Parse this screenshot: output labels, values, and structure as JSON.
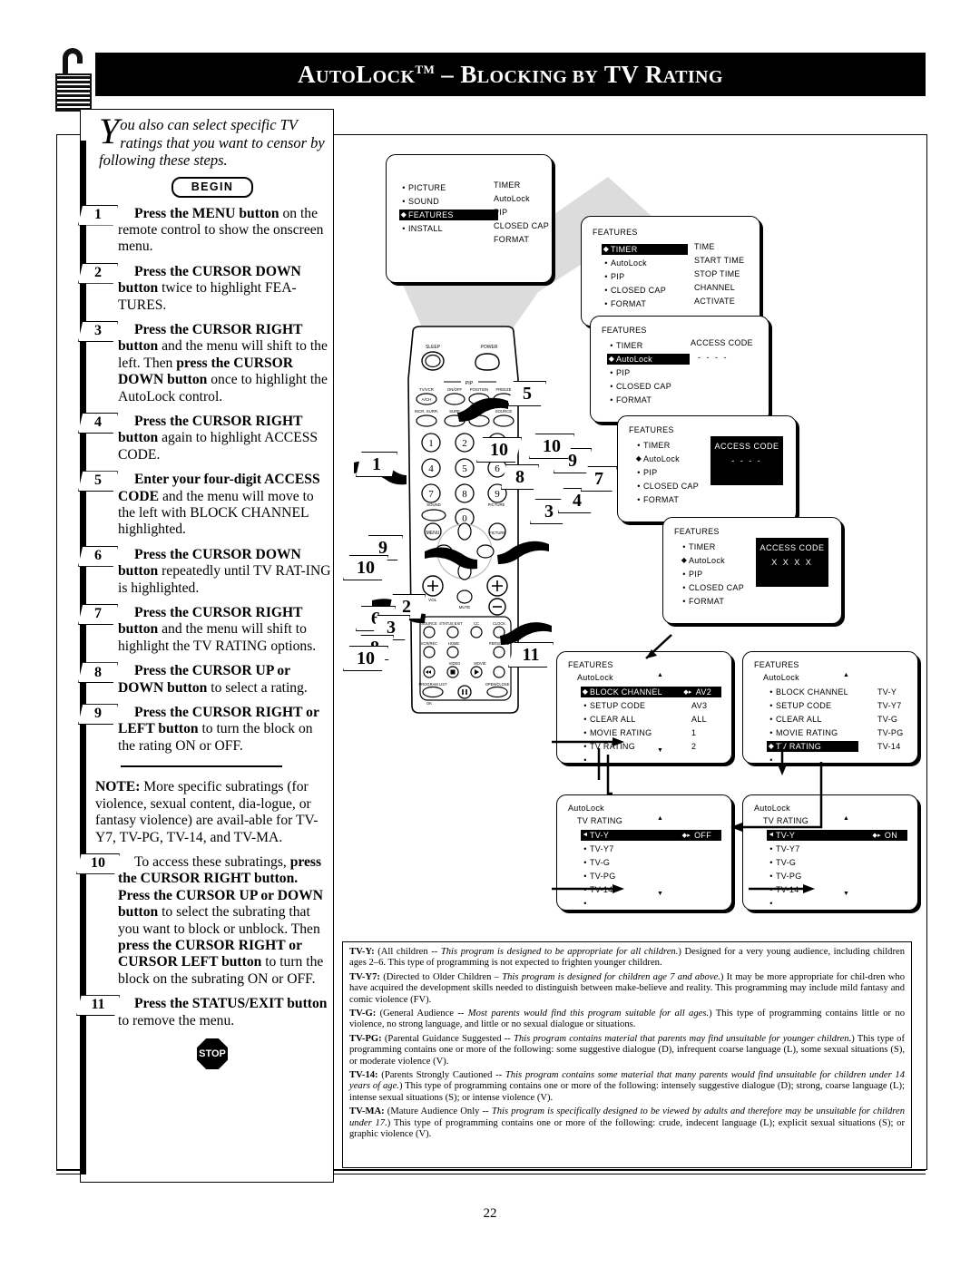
{
  "header": {
    "title_parts": {
      "a": "A",
      "b": "UTO",
      "c": "L",
      "d": "OCK",
      "tm": "TM",
      "dash": " – ",
      "e": "B",
      "f": "LOCKING",
      "g": " BY ",
      "h": "TV ",
      "i": "R",
      "j": "ATING"
    },
    "title_plain": "AutoLock™ – Blocking by TV Rating",
    "lock_icon": "padlock-open-icon"
  },
  "intro": {
    "dropcap": "Y",
    "text": "ou also can select specific TV ratings that you want to censor by following these steps."
  },
  "badges": {
    "begin": "BEGIN",
    "stop": "STOP"
  },
  "steps": [
    {
      "n": "1",
      "html": "<b>Press the MENU button</b> on the remote control to show the onscreen menu."
    },
    {
      "n": "2",
      "html": "<b>Press the CURSOR DOWN button</b> twice to highlight FEA-TURES."
    },
    {
      "n": "3",
      "html": "<b>Press the CURSOR RIGHT button</b> and the menu will shift to the left. Then <b>press the CURSOR DOWN button</b> once to highlight the AutoLock control."
    },
    {
      "n": "4",
      "html": "<b>Press the CURSOR RIGHT button</b> again to highlight ACCESS CODE."
    },
    {
      "n": "5",
      "html": "<b>Enter your four-digit ACCESS CODE</b> and the menu will move to the left with BLOCK CHANNEL highlighted."
    },
    {
      "n": "6",
      "html": "<b>Press the CURSOR DOWN button</b> repeatedly until TV RAT-ING is highlighted."
    },
    {
      "n": "7",
      "html": "<b>Press the CURSOR RIGHT button</b> and the menu will shift to highlight the TV RATING options."
    },
    {
      "n": "8",
      "html": "<b>Press the CURSOR UP or DOWN button</b> to select a rating."
    },
    {
      "n": "9",
      "html": "<b>Press the CURSOR RIGHT or LEFT button</b> to turn the block on the rating ON or OFF."
    }
  ],
  "note": {
    "label": "NOTE:",
    "text": " More specific subratings (for violence, sexual content, dia-logue, or fantasy violence) are avail-able for TV-Y7, TV-PG, TV-14, and TV-MA."
  },
  "steps_after_note": [
    {
      "n": "10",
      "html": "To access these subratings, <b>press the CURSOR RIGHT button. Press the CURSOR UP or DOWN button</b> to select the subrating that you want to block or unblock. Then <b>press the CURSOR RIGHT or CURSOR LEFT button</b> to turn the block on the subrating ON or OFF."
    },
    {
      "n": "11",
      "html": "<b>Press the STATUS/EXIT button</b> to remove the menu."
    }
  ],
  "screens": {
    "s1": {
      "items": [
        {
          "bullet": "•",
          "label": "PICTURE",
          "hl": false
        },
        {
          "bullet": "•",
          "label": "SOUND",
          "hl": false
        },
        {
          "bullet": "cursor",
          "label": "FEATURES",
          "hl": true
        },
        {
          "bullet": "•",
          "label": "INSTALL",
          "hl": false
        }
      ],
      "right": [
        "TIMER",
        "AutoLock",
        "PIP",
        "CLOSED CAP",
        "FORMAT"
      ]
    },
    "s2": {
      "header": "FEATURES",
      "items": [
        {
          "bullet": "cursor",
          "label": "TIMER",
          "hl": true
        },
        {
          "bullet": "•",
          "label": "AutoLock",
          "hl": false
        },
        {
          "bullet": "•",
          "label": "PIP",
          "hl": false
        },
        {
          "bullet": "•",
          "label": "CLOSED CAP",
          "hl": false
        },
        {
          "bullet": "•",
          "label": "FORMAT",
          "hl": false
        }
      ],
      "right": [
        "TIME",
        "START TIME",
        "STOP TIME",
        "CHANNEL",
        "ACTIVATE"
      ]
    },
    "s3": {
      "header": "FEATURES",
      "items": [
        {
          "bullet": "•",
          "label": "TIMER",
          "hl": false
        },
        {
          "bullet": "cursor",
          "label": "AutoLock",
          "hl": true
        },
        {
          "bullet": "•",
          "label": "PIP",
          "hl": false
        },
        {
          "bullet": "•",
          "label": "CLOSED CAP",
          "hl": false
        },
        {
          "bullet": "•",
          "label": "FORMAT",
          "hl": false
        }
      ],
      "right_title": "ACCESS CODE",
      "right_value": "- - - -"
    },
    "s4": {
      "header": "FEATURES",
      "items": [
        {
          "bullet": "•",
          "label": "TIMER",
          "hl": false
        },
        {
          "bullet": "cursor",
          "label": "AutoLock",
          "hl": false
        },
        {
          "bullet": "•",
          "label": "PIP",
          "hl": false
        },
        {
          "bullet": "•",
          "label": "CLOSED CAP",
          "hl": false
        },
        {
          "bullet": "•",
          "label": "FORMAT",
          "hl": false
        }
      ],
      "box_title": "ACCESS CODE",
      "box_value": "- - - -"
    },
    "s5": {
      "header": "FEATURES",
      "items": [
        {
          "bullet": "•",
          "label": "TIMER",
          "hl": false
        },
        {
          "bullet": "cursor",
          "label": "AutoLock",
          "hl": false
        },
        {
          "bullet": "•",
          "label": "PIP",
          "hl": false
        },
        {
          "bullet": "•",
          "label": "CLOSED CAP",
          "hl": false
        },
        {
          "bullet": "•",
          "label": "FORMAT",
          "hl": false
        }
      ],
      "box_title": "ACCESS CODE",
      "box_value": "X X X X"
    },
    "s6": {
      "header": "FEATURES",
      "sub": "AutoLock",
      "items": [
        {
          "bullet": "cursor",
          "label": "BLOCK CHANNEL",
          "hl": true,
          "val": "AV2",
          "valcur": true
        },
        {
          "bullet": "•",
          "label": "SETUP CODE",
          "hl": false,
          "val": "AV3"
        },
        {
          "bullet": "•",
          "label": "CLEAR ALL",
          "hl": false,
          "val": "ALL"
        },
        {
          "bullet": "•",
          "label": "MOVIE RATING",
          "hl": false,
          "val": "1"
        },
        {
          "bullet": "•",
          "label": "TV RATING",
          "hl": false,
          "val": "2"
        },
        {
          "bullet": "•",
          "label": "",
          "hl": false,
          "val": ""
        }
      ]
    },
    "s7": {
      "header": "FEATURES",
      "sub": "AutoLock",
      "items": [
        {
          "bullet": "•",
          "label": "BLOCK CHANNEL",
          "hl": false,
          "val": "TV-Y"
        },
        {
          "bullet": "•",
          "label": "SETUP CODE",
          "hl": false,
          "val": "TV-Y7"
        },
        {
          "bullet": "•",
          "label": "CLEAR ALL",
          "hl": false,
          "val": "TV-G"
        },
        {
          "bullet": "•",
          "label": "MOVIE RATING",
          "hl": false,
          "val": "TV-PG"
        },
        {
          "bullet": "cursor",
          "label": "TV RATING",
          "hl": true,
          "val": "TV-14"
        },
        {
          "bullet": "•",
          "label": "",
          "hl": false,
          "val": ""
        }
      ]
    },
    "s8": {
      "header": "AutoLock",
      "sub": "TV RATING",
      "items": [
        {
          "bullet": "left",
          "label": "TV-Y",
          "hl": true,
          "val": "OFF",
          "valcur": true
        },
        {
          "bullet": "•",
          "label": "TV-Y7",
          "hl": false,
          "val": ""
        },
        {
          "bullet": "•",
          "label": "TV-G",
          "hl": false,
          "val": ""
        },
        {
          "bullet": "•",
          "label": "TV-PG",
          "hl": false,
          "val": ""
        },
        {
          "bullet": "•",
          "label": "TV-14",
          "hl": false,
          "val": ""
        },
        {
          "bullet": "•",
          "label": "",
          "hl": false,
          "val": ""
        }
      ]
    },
    "s9": {
      "header": "AutoLock",
      "sub": "TV RATING",
      "items": [
        {
          "bullet": "left",
          "label": "TV-Y",
          "hl": true,
          "val": "ON",
          "valcur": true
        },
        {
          "bullet": "•",
          "label": "TV-Y7",
          "hl": false,
          "val": ""
        },
        {
          "bullet": "•",
          "label": "TV-G",
          "hl": false,
          "val": ""
        },
        {
          "bullet": "•",
          "label": "TV-PG",
          "hl": false,
          "val": ""
        },
        {
          "bullet": "•",
          "label": "TV-14",
          "hl": false,
          "val": ""
        },
        {
          "bullet": "•",
          "label": "",
          "hl": false,
          "val": ""
        }
      ]
    }
  },
  "remote": {
    "buttons": [
      "SLEEP",
      "POWER",
      "PIP",
      "TV/VCR",
      "A/CH",
      "ON/OFF",
      "POSITION",
      "FREEZE",
      "INCR. SURR.",
      "SURF",
      "SWAP",
      "SOURCE",
      "SOUND",
      "PICTURE",
      "MENU",
      "VOL",
      "CH",
      "MUTE",
      "STATUS EXIT",
      "CC",
      "CLOCK",
      "VCR/REC",
      "HOME",
      "PERSONAL",
      "VIDEO",
      "MOVIE",
      "PROGRAM LIST",
      "OPEN/CLOSE",
      "OK"
    ],
    "keypad": [
      "1",
      "2",
      "3",
      "4",
      "5",
      "6",
      "7",
      "8",
      "9",
      "0"
    ],
    "callouts": [
      "1",
      "2",
      "3",
      "4",
      "5",
      "6",
      "7",
      "8",
      "9",
      "10",
      "11"
    ]
  },
  "ratings": [
    {
      "code": "TV-Y:",
      "html": " (All children -- <i>This program is designed to be appropriate for all children.</i>)  Designed for a very young audience, including children ages 2&ndash;6.  This type of programming is not expected to frighten younger children."
    },
    {
      "code": "TV-Y7:",
      "html": "  (Directed to Older Children &ndash; <i>This program is designed for children age 7 and above.</i>)  It may be more appropriate for chil-dren who have acquired the development skills needed to distinguish between make-believe and reality.  This programming may include mild fantasy and comic violence (FV)."
    },
    {
      "code": "TV-G:",
      "html": "  (General Audience -- <i>Most parents would find this program suitable for all ages.</i>)  This type of programming contains little or no violence, no strong language, and little or no sexual dialogue or situations."
    },
    {
      "code": "TV-PG:",
      "html": "  (Parental Guidance Suggested -- <i>This program contains material that parents may find unsuitable for younger children.</i>)  This type of programming contains one or more of the following:  some suggestive dialogue (D), infrequent coarse language (L), some sexual situations (S), or moderate violence (V)."
    },
    {
      "code": "TV-14:",
      "html": "  (Parents Strongly Cautioned -- <i>This program contains some material that many parents would find unsuitable for children under 14 years of age.</i>)  This type of programming contains one or more of the following:  intensely suggestive dialogue (D); strong, coarse language (L); intense sexual situations (S); or intense violence (V)."
    },
    {
      "code": "TV-MA:",
      "html": "  (Mature Audience Only -- <i>This program is specifically designed to be viewed by adults and therefore may be unsuitable for children under 17.</i>)  This type of programming contains one or more of the following:  crude, indecent language (L); explicit sexual situations (S); or graphic violence (V)."
    }
  ],
  "page_number": "22"
}
